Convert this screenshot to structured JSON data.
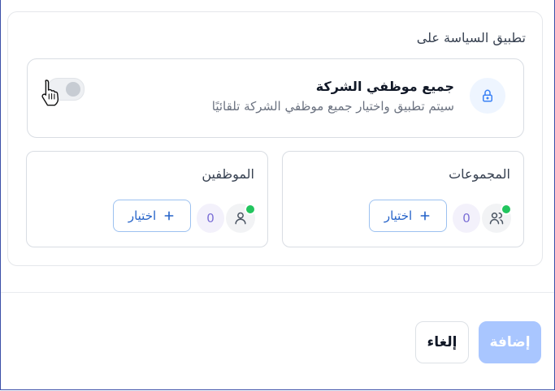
{
  "section": {
    "title": "تطبيق السياسة على"
  },
  "policy": {
    "title": "جميع موظفي الشركة",
    "description": "سيتم تطبيق واختيار جميع موظفي الشركة تلقائيًا",
    "toggle_on": false,
    "icon": "lock-icon"
  },
  "groups": {
    "title": "المجموعات",
    "count": "0",
    "select_label": "اختيار",
    "icon": "users-icon"
  },
  "employees": {
    "title": "الموظفين",
    "count": "0",
    "select_label": "اختيار",
    "icon": "user-icon"
  },
  "footer": {
    "add_label": "إضافة",
    "cancel_label": "إلغاء"
  },
  "colors": {
    "accent": "#2563c9",
    "add_button": "#a9c6ff",
    "online": "#22c55e",
    "count_text": "#7b6fd6"
  }
}
